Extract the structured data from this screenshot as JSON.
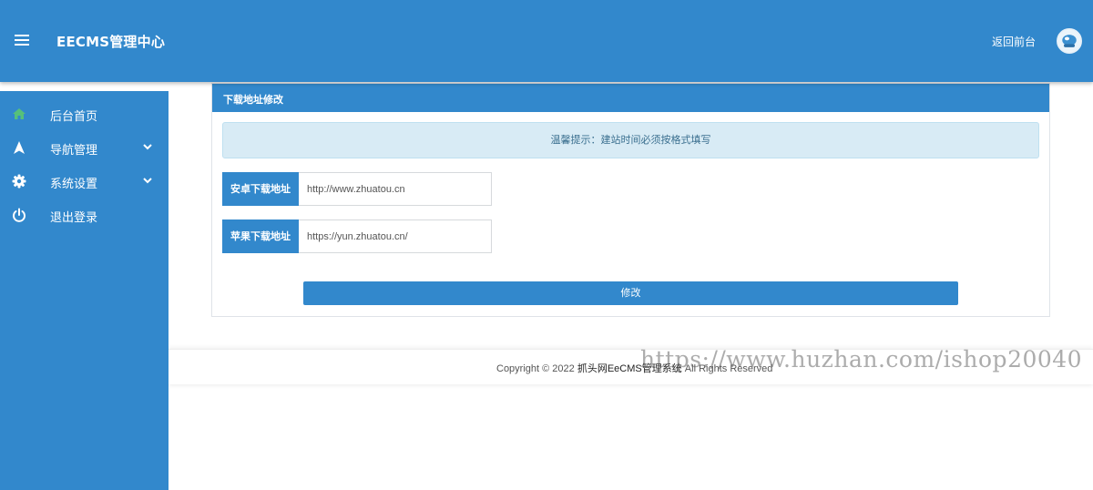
{
  "header": {
    "app_title": "EECMS管理中心",
    "frontend_link": "返回前台",
    "menu_icon": "hamburger-menu-icon",
    "avatar_icon": "user-avatar-icon"
  },
  "sidebar": {
    "items": [
      {
        "label": "后台首页",
        "icon": "home-icon",
        "has_submenu": false
      },
      {
        "label": "导航管理",
        "icon": "navigation-arrow-icon",
        "has_submenu": true
      },
      {
        "label": "系统设置",
        "icon": "gear-icon",
        "has_submenu": true
      },
      {
        "label": "退出登录",
        "icon": "power-icon",
        "has_submenu": false
      }
    ]
  },
  "panel": {
    "title": "下载地址修改",
    "tip": "温馨提示：建站时间必须按格式填写",
    "fields": [
      {
        "label": "安卓下载地址",
        "value": "http://www.zhuatou.cn"
      },
      {
        "label": "苹果下载地址",
        "value": "https://yun.zhuatou.cn/"
      }
    ],
    "submit_label": "修改"
  },
  "footer": {
    "copyright": "Copyright © 2022",
    "brand": "抓头网EeCMS管理系统",
    "rights": "All Rights Reserved"
  },
  "watermark": "https://www.huzhan.com/ishop20040",
  "colors": {
    "primary": "#3288cc",
    "tip_background": "#d8ebf5",
    "home_icon": "#56c07a"
  }
}
